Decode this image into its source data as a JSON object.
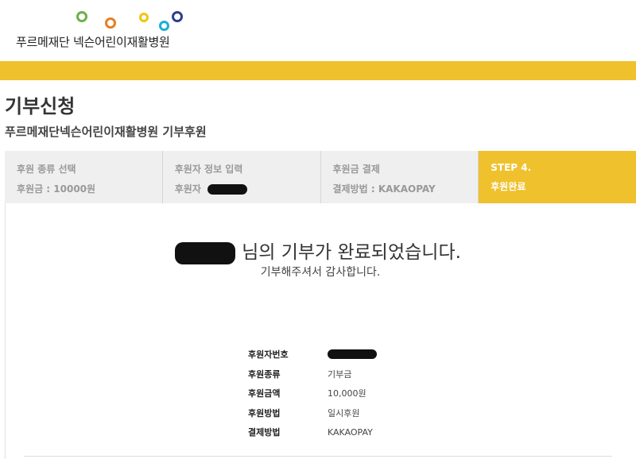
{
  "header": {
    "logo_text": "푸르메재단 넥슨어린이재활병원",
    "colors": {
      "green": "#6ab04c",
      "orange": "#e67e22",
      "yellow": "#f1c40f",
      "teal": "#1ab0d0",
      "navy": "#2c3e8c"
    }
  },
  "accent_color": "#efc12d",
  "page": {
    "title": "기부신청",
    "subtitle": "푸르메재단넥슨어린이재활병원 기부후원"
  },
  "steps": [
    {
      "title": "후원 종류 선택",
      "detail": "후원금 : 10000원"
    },
    {
      "title": "후원자 정보 입력",
      "detail": "후원자"
    },
    {
      "title": "후원금 결제",
      "detail": "결제방법 : KAKAOPAY"
    },
    {
      "title": "STEP 4.",
      "detail": "후원완료"
    }
  ],
  "message": {
    "complete_suffix": "님의 기부가 완료되었습니다.",
    "thanks": "기부해주셔서 감사합니다."
  },
  "info": [
    {
      "label": "후원자번호",
      "value": ""
    },
    {
      "label": "후원종류",
      "value": "기부금"
    },
    {
      "label": "후원금액",
      "value": "10,000원"
    },
    {
      "label": "후원방법",
      "value": "일시후원"
    },
    {
      "label": "결제방법",
      "value": "KAKAOPAY"
    }
  ]
}
